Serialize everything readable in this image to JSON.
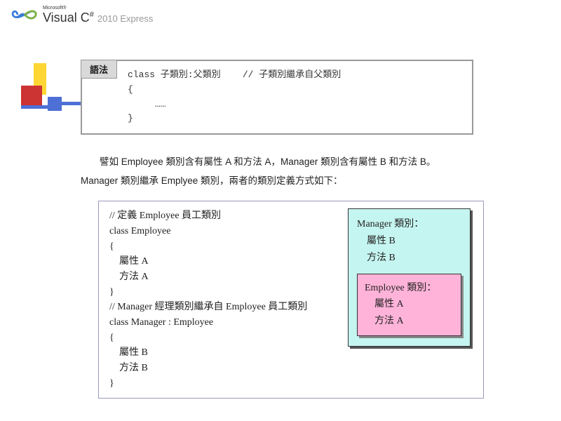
{
  "header": {
    "microsoft": "Microsoft®",
    "product": "Visual C",
    "sharp": "#",
    "version": "2010 Express"
  },
  "syntax": {
    "label": "語法",
    "code": "class 子類別:父類別    // 子類別繼承自父類別\n{\n     ……\n}"
  },
  "explanation": {
    "line1": "譬如 Employee 類別含有屬性 A 和方法 A，Manager 類別含有屬性 B 和方法 B。",
    "line2": "Manager 類別繼承 Emplyee 類別，兩者的類別定義方式如下："
  },
  "code": {
    "text": "// 定義 Employee 員工類別\nclass Employee\n{\n    屬性 A\n    方法 A\n}\n// Manager 經理類別繼承自 Employee 員工類別\nclass Manager : Employee\n{\n    屬性 B\n    方法 B\n}"
  },
  "diagram": {
    "outer": "Manager 類別：\n    屬性 B\n    方法 B",
    "inner": "Employee 類別：\n    屬性 A\n    方法 A"
  }
}
